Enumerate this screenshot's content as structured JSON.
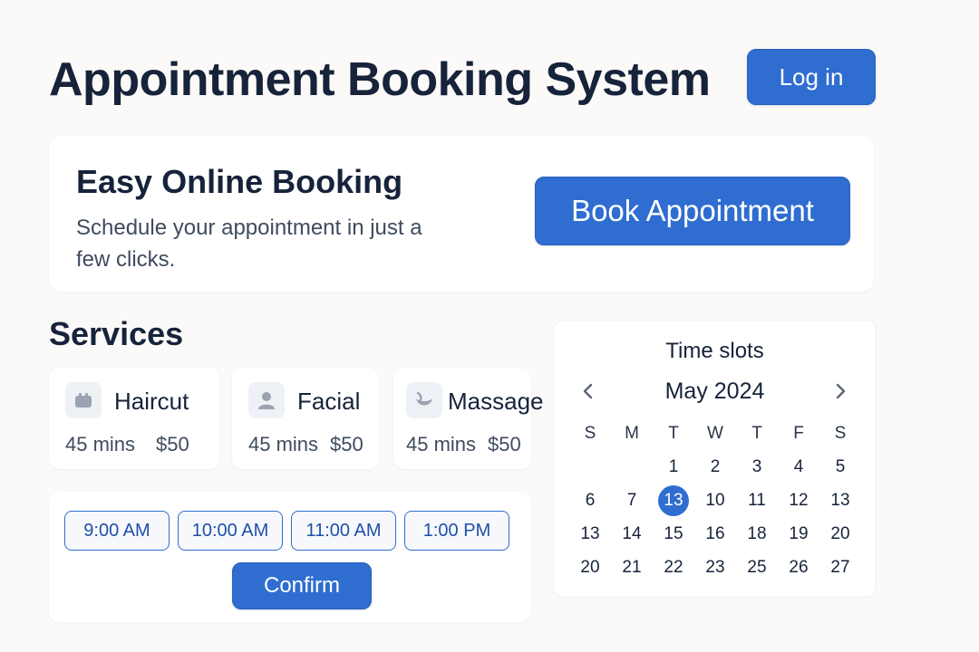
{
  "app": {
    "title": "Appointment Booking System",
    "login_label": "Log in"
  },
  "hero": {
    "title": "Easy Online Booking",
    "subtitle": "Schedule your appointment in just a few clicks.",
    "book_label": "Book Appointment"
  },
  "services": {
    "title": "Services",
    "items": [
      {
        "name": "Haircut",
        "duration": "45 mins",
        "price": "$50",
        "icon": "haircut-icon"
      },
      {
        "name": "Facial",
        "duration": "45 mins",
        "price": "$50",
        "icon": "person-icon"
      },
      {
        "name": "Massage",
        "duration": "45 mins",
        "price": "$50",
        "icon": "massage-icon"
      }
    ]
  },
  "slots": {
    "times": [
      "9:00 AM",
      "10:00 AM",
      "11:00 AM",
      "1:00 PM"
    ],
    "confirm_label": "Confirm"
  },
  "calendar": {
    "title": "Time slots",
    "month": "May 2024",
    "weekdays": [
      "S",
      "M",
      "T",
      "W",
      "T",
      "F",
      "S"
    ],
    "weeks": [
      [
        "",
        "",
        "1",
        "2",
        "3",
        "4",
        "5"
      ],
      [
        "6",
        "7",
        "13",
        "10",
        "11",
        "12",
        "13"
      ],
      [
        "13",
        "14",
        "15",
        "16",
        "18",
        "19",
        "20"
      ],
      [
        "20",
        "21",
        "22",
        "23",
        "25",
        "26",
        "27"
      ]
    ],
    "selected": {
      "week": 1,
      "day": 2
    }
  },
  "colors": {
    "accent": "#2f6dd0",
    "text": "#16233a",
    "muted": "#3f4b5e",
    "background": "#fbfaf8"
  }
}
